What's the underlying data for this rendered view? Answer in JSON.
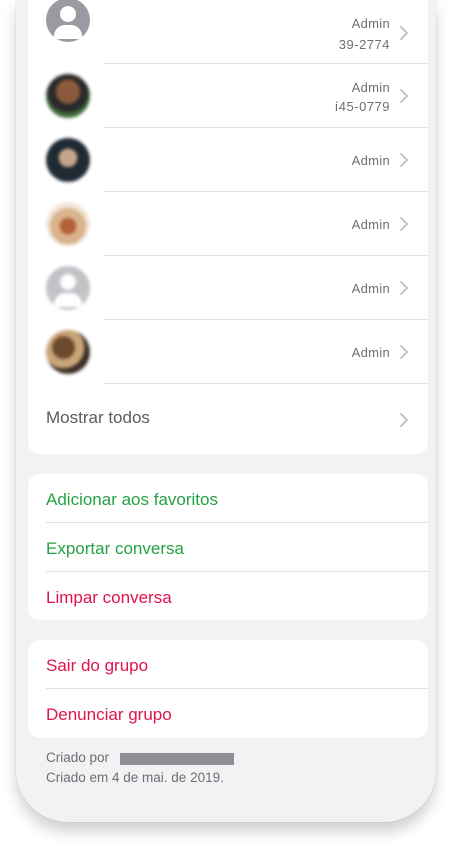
{
  "members": [
    {
      "avatar": "placeholder",
      "role": "Admin",
      "phone": "39-2774"
    },
    {
      "avatar": "photo",
      "role": "Admin",
      "phone": "í45-0779"
    },
    {
      "avatar": "photo",
      "role": "Admin"
    },
    {
      "avatar": "photo",
      "role": "Admin"
    },
    {
      "avatar": "placeholder",
      "role": "Admin"
    },
    {
      "avatar": "photo",
      "role": "Admin"
    }
  ],
  "show_all_label": "Mostrar todos",
  "actions": {
    "favorites": "Adicionar aos favoritos",
    "export": "Exportar conversa",
    "clear": "Limpar conversa"
  },
  "danger": {
    "leave": "Sair do grupo",
    "report": "Denunciar grupo"
  },
  "footer": {
    "created_by": "Criado por",
    "created_on": "Criado em 4 de mai. de 2019."
  },
  "colors": {
    "green": "#25a244",
    "red": "#e0134d",
    "background": "#f2f2f4"
  },
  "icons": [
    "person-placeholder-icon",
    "chevron-right-icon"
  ]
}
